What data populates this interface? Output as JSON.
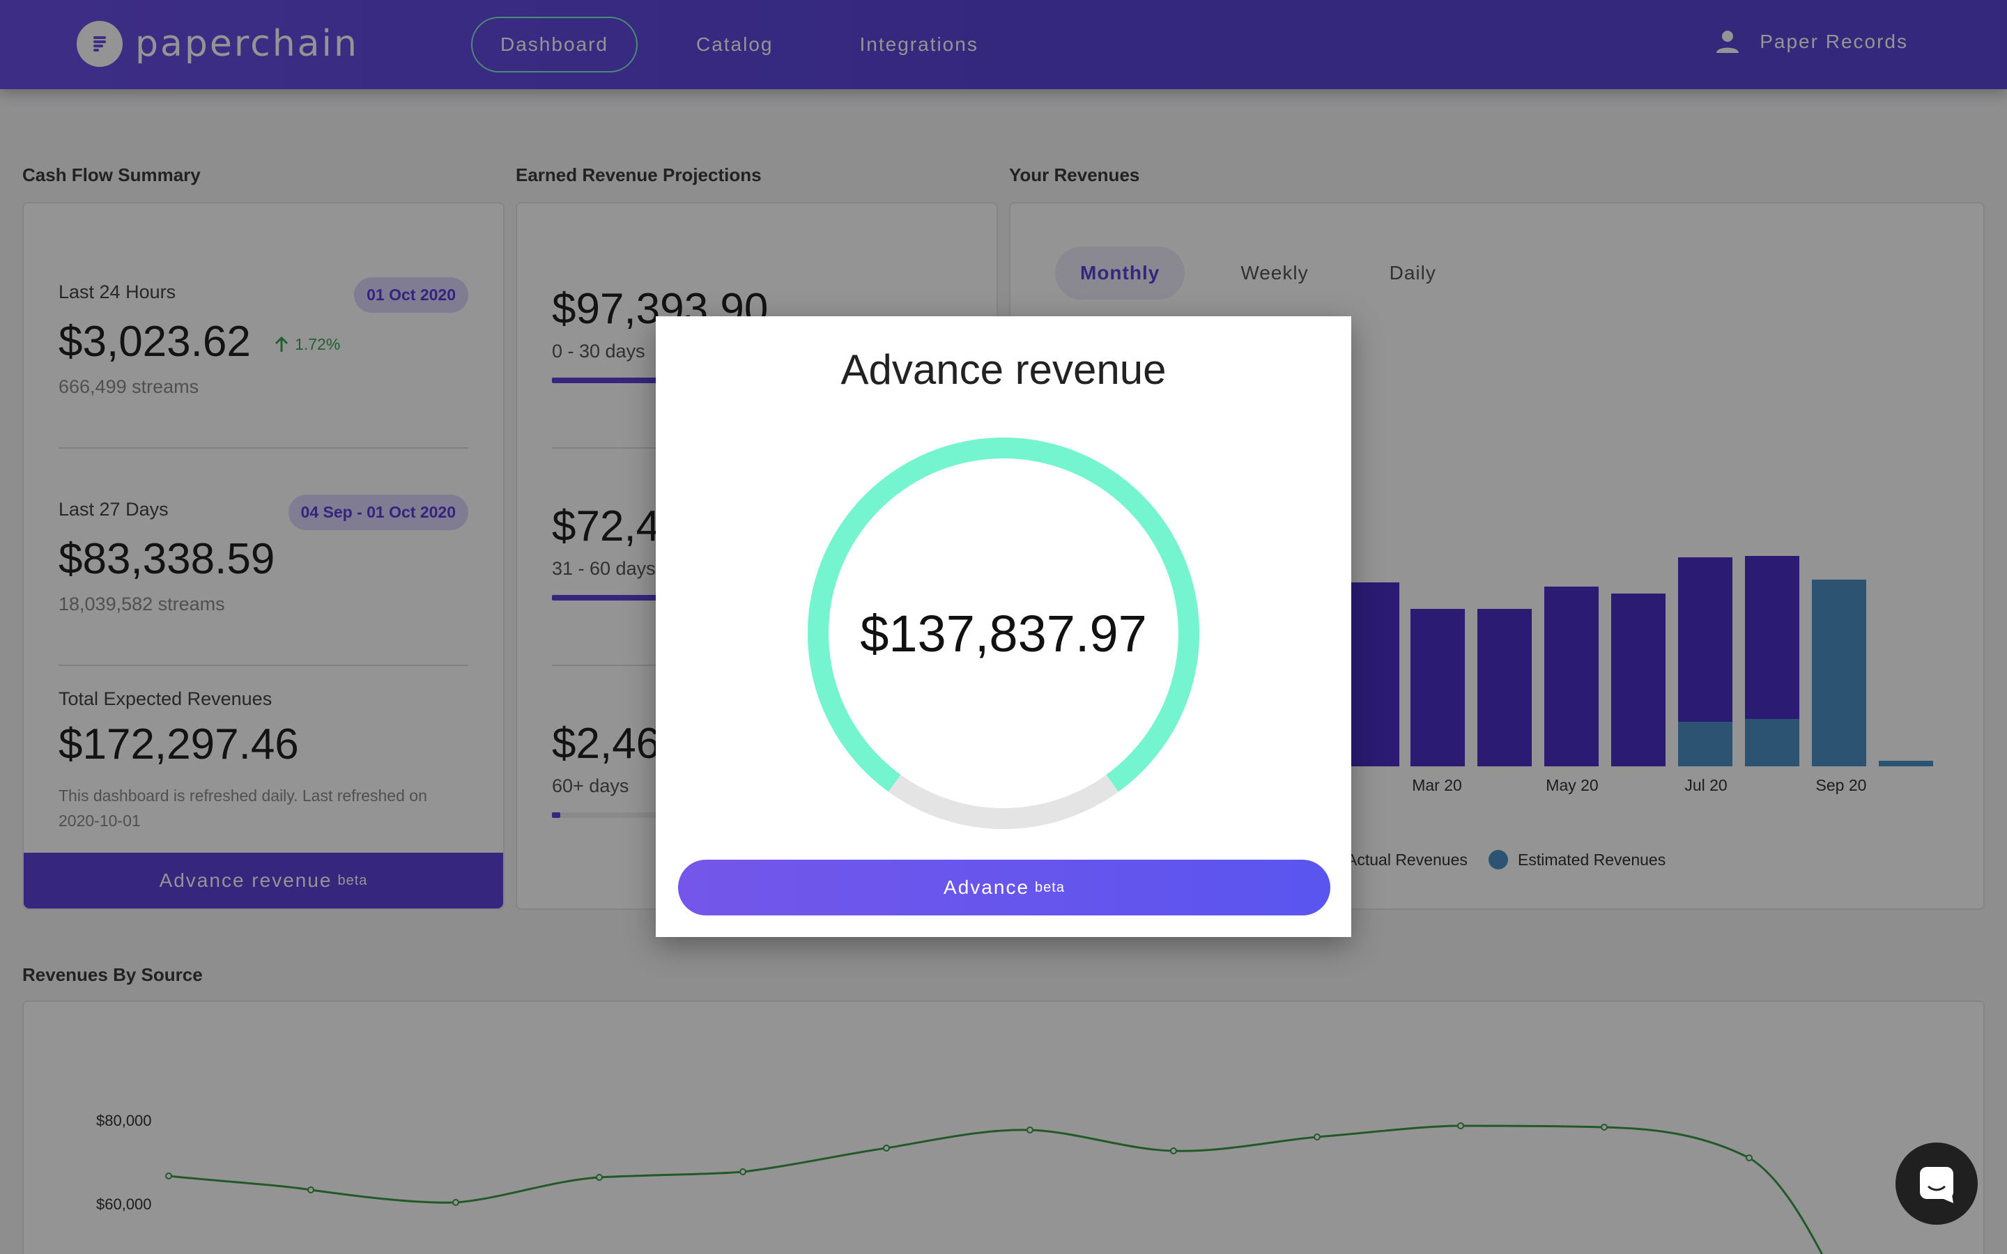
{
  "brand": {
    "name": "paperchain",
    "logo_icon": "paperchain-logo-icon"
  },
  "nav": {
    "items": [
      {
        "label": "Dashboard",
        "active": true
      },
      {
        "label": "Catalog",
        "active": false
      },
      {
        "label": "Integrations",
        "active": false
      }
    ],
    "account_label": "Paper Records",
    "account_icon": "person-icon"
  },
  "cash_flow": {
    "title": "Cash Flow Summary",
    "last24": {
      "label": "Last 24 Hours",
      "badge": "01 Oct 2020",
      "value": "$3,023.62",
      "delta": "1.72%",
      "streams": "666,499 streams"
    },
    "last27": {
      "label": "Last 27 Days",
      "badge": "04 Sep - 01 Oct 2020",
      "value": "$83,338.59",
      "streams": "18,039,582 streams"
    },
    "total": {
      "label": "Total Expected Revenues",
      "value": "$172,297.46",
      "note": "This dashboard is refreshed daily. Last refreshed on 2020-10-01"
    },
    "button_label": "Advance revenue",
    "button_sup": "beta"
  },
  "projections": {
    "title": "Earned Revenue Projections",
    "items": [
      {
        "value": "$97,393.90",
        "range": "0 - 30 days",
        "fill": 0.56
      },
      {
        "value": "$72,4",
        "range": "31 - 60 days",
        "fill": 0.42
      },
      {
        "value": "$2,46",
        "range": "60+ days",
        "fill": 0.02
      }
    ]
  },
  "revenues": {
    "title": "Your Revenues",
    "tabs": [
      "Monthly",
      "Weekly",
      "Daily"
    ],
    "active_tab": "Monthly",
    "x_labels": [
      "Mar 20",
      "May 20",
      "Jul 20",
      "Sep 20"
    ],
    "legend": [
      {
        "label": "Actual Revenues",
        "color": "#4a2fc7"
      },
      {
        "label": "Estimated Revenues",
        "color": "#4d8fc4"
      }
    ],
    "colors": {
      "actual": "#4a2fc7",
      "estimated": "#4d8fc4"
    }
  },
  "by_source": {
    "title": "Revenues By Source",
    "y_ticks": [
      "$80,000",
      "$60,000"
    ]
  },
  "modal": {
    "title": "Advance revenue",
    "amount": "$137,837.97",
    "progress": 0.8,
    "button_label": "Advance",
    "button_sup": "beta",
    "colors": {
      "ring": "#74f5cf",
      "track": "#e4e4e4"
    }
  },
  "chat_icon": "chat-icon"
}
